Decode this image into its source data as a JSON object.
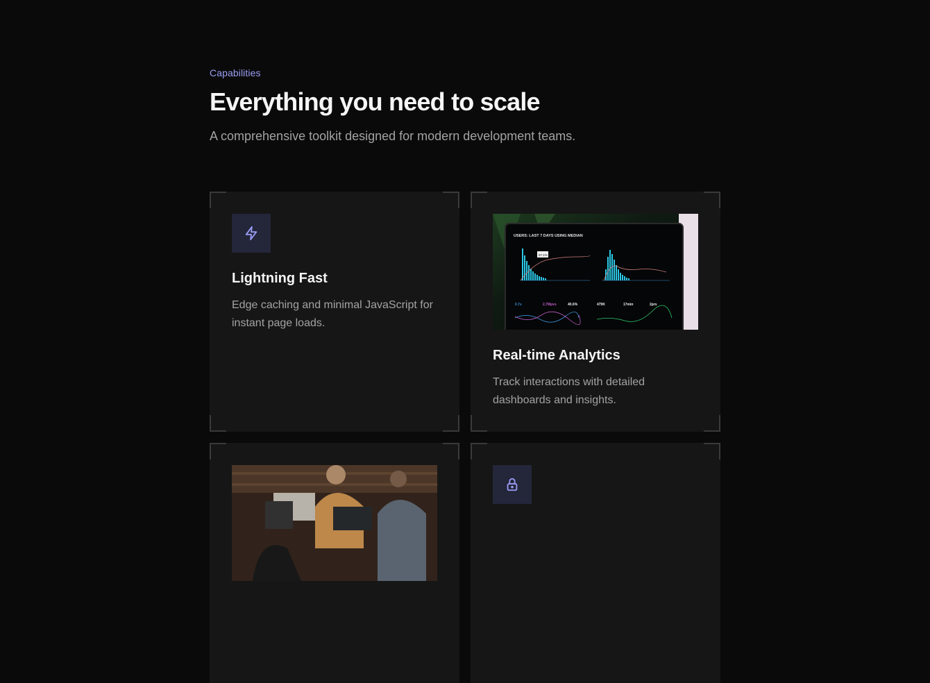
{
  "header": {
    "eyebrow": "Capabilities",
    "title": "Everything you need to scale",
    "subtitle": "A comprehensive toolkit designed for modern development teams."
  },
  "cards": [
    {
      "icon": "lightning-icon",
      "title": "Lightning Fast",
      "description": "Edge caching and minimal JavaScript for instant page loads."
    },
    {
      "image": "analytics-dashboard-photo",
      "title": "Real-time Analytics",
      "description": "Track interactions with detailed dashboards and insights.",
      "dashboard": {
        "heading": "USERS: LAST 7 DAYS USING MEDIAN",
        "tooltip": "57.1%",
        "metrics": [
          "0.7s",
          "2.7Mpvs",
          "40.6%",
          "479K",
          "17min",
          "2prs"
        ]
      }
    },
    {
      "image": "team-collaboration-photo"
    },
    {
      "icon": "lock-icon"
    }
  ],
  "colors": {
    "background": "#0a0a0a",
    "card": "#161616",
    "accent": "#9a9cf5",
    "icon_box": "#24263a"
  }
}
